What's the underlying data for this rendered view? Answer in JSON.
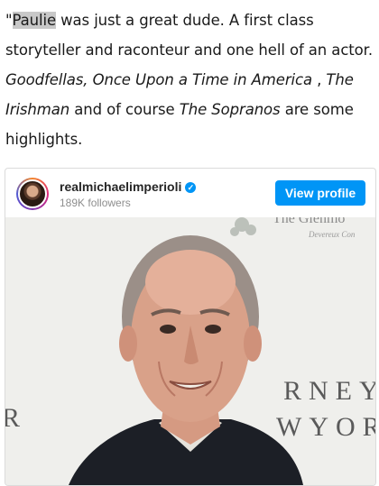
{
  "article": {
    "p1": "\"",
    "highlight": "Paulie",
    "p2": " was just a great dude. A first class storyteller and raconteur and one hell of an actor. ",
    "film1": "Goodfellas, Once Upon a Time in America",
    "p3": " , ",
    "film2": "The Irishman",
    "p4": " and of course ",
    "film3": "The Sopranos",
    "p5": " are some highlights."
  },
  "embed": {
    "username": "realmichaelimperioli",
    "verified_icon": "verified-badge-icon",
    "followers": "189K followers",
    "view_profile_label": "View profile",
    "backdrop_top_line": "The Glenmo",
    "backdrop_sub_line": "Devereux Con",
    "backdrop_right_top": "RNEY",
    "backdrop_right_bottom": "WYOR",
    "backdrop_left": "R"
  },
  "colors": {
    "accent": "#0095f6",
    "highlight": "#c8c8c8"
  }
}
